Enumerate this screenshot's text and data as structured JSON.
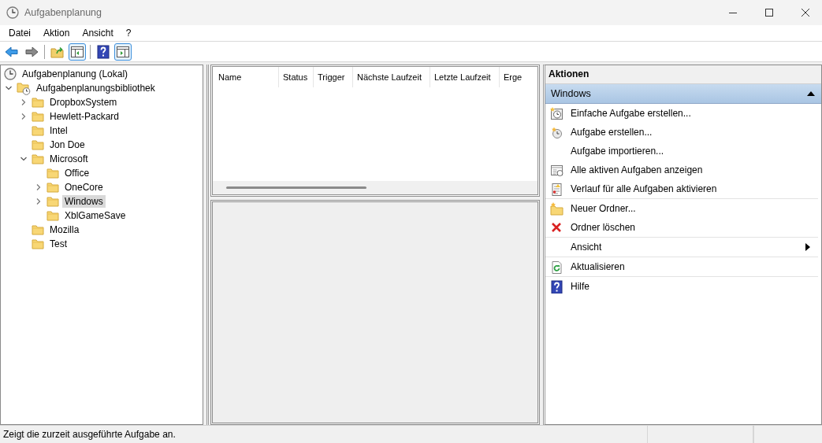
{
  "window": {
    "title": "Aufgabenplanung"
  },
  "menu": [
    "Datei",
    "Aktion",
    "Ansicht",
    "?"
  ],
  "toolbar": [
    {
      "kind": "back",
      "selected": false
    },
    {
      "kind": "forward",
      "selected": false
    },
    {
      "kind": "separator"
    },
    {
      "kind": "up",
      "selected": false
    },
    {
      "kind": "tree-pane",
      "selected": true
    },
    {
      "kind": "separator"
    },
    {
      "kind": "help",
      "selected": false
    },
    {
      "kind": "action-pane",
      "selected": true
    }
  ],
  "tree": [
    {
      "label": "Aufgabenplanung (Lokal)",
      "kind": "clock",
      "selected": false
    },
    {
      "label": "Aufgabenplanungsbibliothek",
      "kind": "library",
      "expanded": true,
      "selected": false,
      "children": [
        {
          "label": "DropboxSystem",
          "kind": "folder",
          "expanded": false,
          "selected": false
        },
        {
          "label": "Hewlett-Packard",
          "kind": "folder",
          "expanded": false,
          "selected": false
        },
        {
          "label": "Intel",
          "kind": "folder",
          "selected": false
        },
        {
          "label": "Jon Doe",
          "kind": "folder",
          "selected": false
        },
        {
          "label": "Microsoft",
          "kind": "folder",
          "expanded": true,
          "selected": false,
          "children": [
            {
              "label": "Office",
              "kind": "folder",
              "selected": false
            },
            {
              "label": "OneCore",
              "kind": "folder",
              "expanded": false,
              "selected": false
            },
            {
              "label": "Windows",
              "kind": "folder",
              "expanded": false,
              "selected": true
            },
            {
              "label": "XblGameSave",
              "kind": "folder",
              "selected": false
            }
          ]
        },
        {
          "label": "Mozilla",
          "kind": "folder",
          "selected": false
        },
        {
          "label": "Test",
          "kind": "folder",
          "selected": false
        }
      ]
    }
  ],
  "table": {
    "columns": [
      "Name",
      "Status",
      "Trigger",
      "Nächste Laufzeit",
      "Letzte Laufzeit",
      "Erge"
    ]
  },
  "actions": {
    "title": "Aktionen",
    "section": {
      "title": "Windows",
      "expanded": true
    },
    "groups": [
      [
        {
          "label": "Einfache Aufgabe erstellen...",
          "kind": "wizard"
        },
        {
          "label": "Aufgabe erstellen...",
          "kind": "task"
        },
        {
          "label": "Aufgabe importieren...",
          "kind": "plain"
        },
        {
          "label": "Alle aktiven Aufgaben anzeigen",
          "kind": "list"
        },
        {
          "label": "Verlauf für alle Aufgaben aktivieren",
          "kind": "log"
        }
      ],
      [
        {
          "label": "Neuer Ordner...",
          "kind": "new-folder"
        },
        {
          "label": "Ordner löschen",
          "kind": "delete"
        }
      ],
      [
        {
          "label": "Ansicht",
          "kind": "plain",
          "submenu": true
        }
      ],
      [
        {
          "label": "Aktualisieren",
          "kind": "refresh"
        }
      ],
      [
        {
          "label": "Hilfe",
          "kind": "help"
        }
      ]
    ]
  },
  "status_bar": {
    "text": "Zeigt die zurzeit ausgeführte Aufgabe an."
  }
}
